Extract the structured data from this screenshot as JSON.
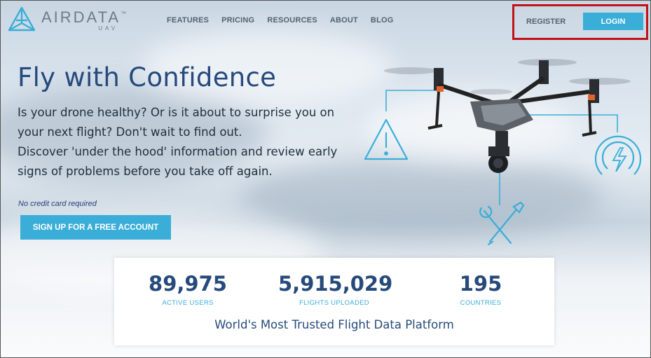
{
  "brand": {
    "name": "AIRDATA",
    "sub": "UAV",
    "tm": "™"
  },
  "nav": [
    {
      "label": "FEATURES"
    },
    {
      "label": "PRICING"
    },
    {
      "label": "RESOURCES"
    },
    {
      "label": "ABOUT"
    },
    {
      "label": "BLOG"
    }
  ],
  "auth": {
    "register_label": "REGISTER",
    "login_label": "LOGIN",
    "highlight_color": "#c1121b"
  },
  "hero": {
    "title": "Fly with Confidence",
    "lines": [
      "Is your drone healthy? Or is it about to surprise you on",
      "your next flight? Don't wait to find out.",
      "Discover 'under the hood' information and review early",
      "signs of problems before you take off again."
    ],
    "no_cc": "No credit card required",
    "signup_label": "SIGN UP FOR A FREE ACCOUNT"
  },
  "graphic_icons": [
    "warning-icon",
    "power-icon",
    "tools-icon",
    "drone-image"
  ],
  "stats": [
    {
      "value": "89,975",
      "label": "ACTIVE USERS"
    },
    {
      "value": "5,915,029",
      "label": "FLIGHTS UPLOADED"
    },
    {
      "value": "195",
      "label": "COUNTRIES"
    }
  ],
  "tagline": "World's Most Trusted Flight Data Platform",
  "colors": {
    "accent": "#3aaed8",
    "title": "#264a7c",
    "nav_text": "#55626f"
  }
}
